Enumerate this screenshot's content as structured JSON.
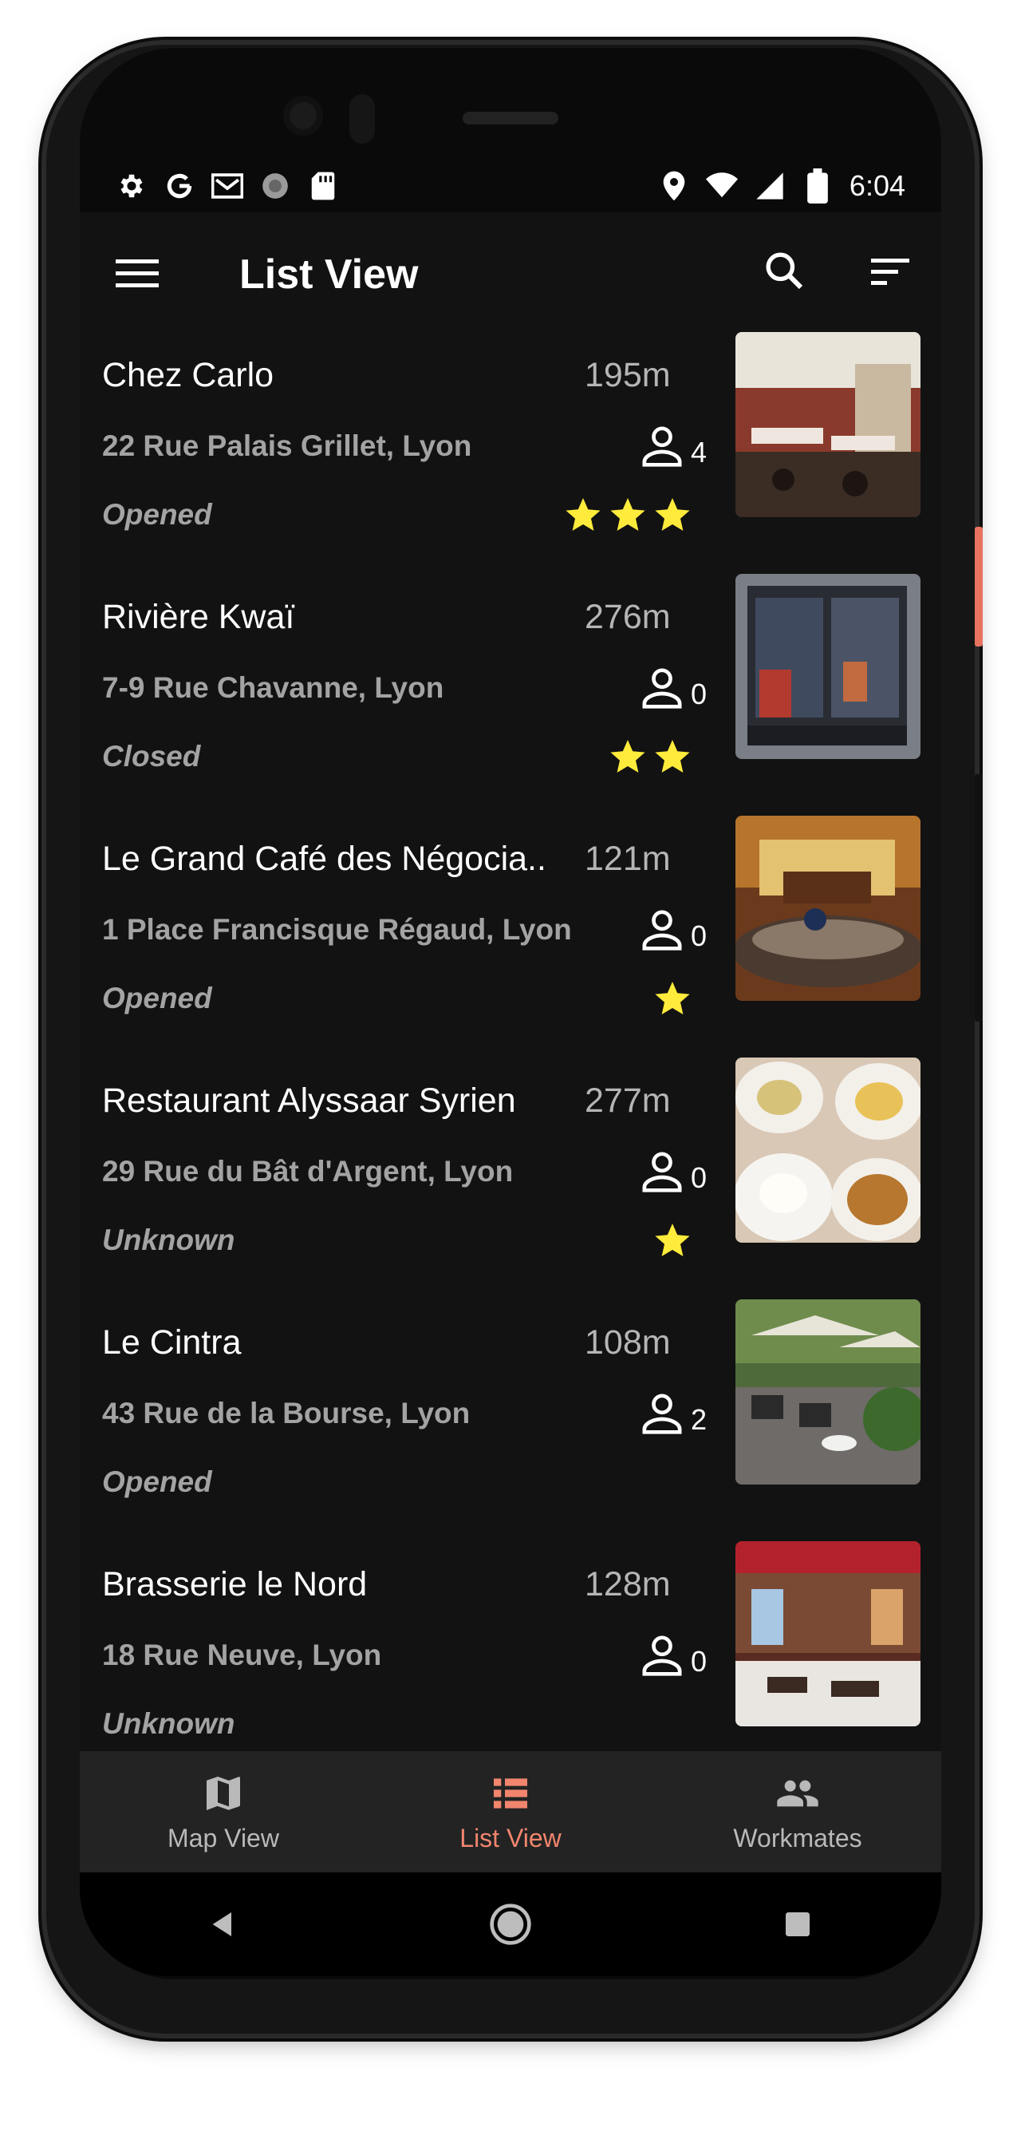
{
  "status_bar": {
    "time": "6:04",
    "left_icons": [
      "settings-icon",
      "google-icon",
      "gmail-icon",
      "sync-icon",
      "sd-card-icon"
    ],
    "right_icons": [
      "location-icon",
      "wifi-icon",
      "signal-icon",
      "battery-icon"
    ]
  },
  "app_bar": {
    "title": "List View",
    "menu_icon": "menu-icon",
    "search_icon": "search-icon",
    "filter_icon": "sort-icon"
  },
  "restaurants": [
    {
      "name": "Chez Carlo",
      "distance": "195m",
      "address": "22 Rue Palais Grillet, Lyon",
      "status": "Opened",
      "workmates": "4",
      "stars": 3
    },
    {
      "name": "Rivière Kwaï",
      "distance": "276m",
      "address": "7-9 Rue Chavanne, Lyon",
      "status": "Closed",
      "workmates": "0",
      "stars": 2
    },
    {
      "name": "Le Grand Café des Négocia..",
      "distance": "121m",
      "address": "1 Place Francisque Régaud, Lyon",
      "status": "Opened",
      "workmates": "0",
      "stars": 1
    },
    {
      "name": "Restaurant Alyssaar Syrien",
      "distance": "277m",
      "address": "29 Rue du Bât d'Argent, Lyon",
      "status": "Unknown",
      "workmates": "0",
      "stars": 1
    },
    {
      "name": "Le Cintra",
      "distance": "108m",
      "address": "43 Rue de la Bourse, Lyon",
      "status": "Opened",
      "workmates": "2",
      "stars": 0
    },
    {
      "name": "Brasserie le Nord",
      "distance": "128m",
      "address": "18 Rue Neuve, Lyon",
      "status": "Unknown",
      "workmates": "0",
      "stars": 0
    }
  ],
  "bottom_nav": {
    "items": [
      {
        "label": "Map View",
        "icon": "map-icon",
        "active": false
      },
      {
        "label": "List View",
        "icon": "list-icon",
        "active": true
      },
      {
        "label": "Workmates",
        "icon": "people-icon",
        "active": false
      }
    ]
  },
  "colors": {
    "background": "#121212",
    "accent": "#f2856d",
    "star": "#ffeb3b",
    "nav_background": "#232323"
  }
}
